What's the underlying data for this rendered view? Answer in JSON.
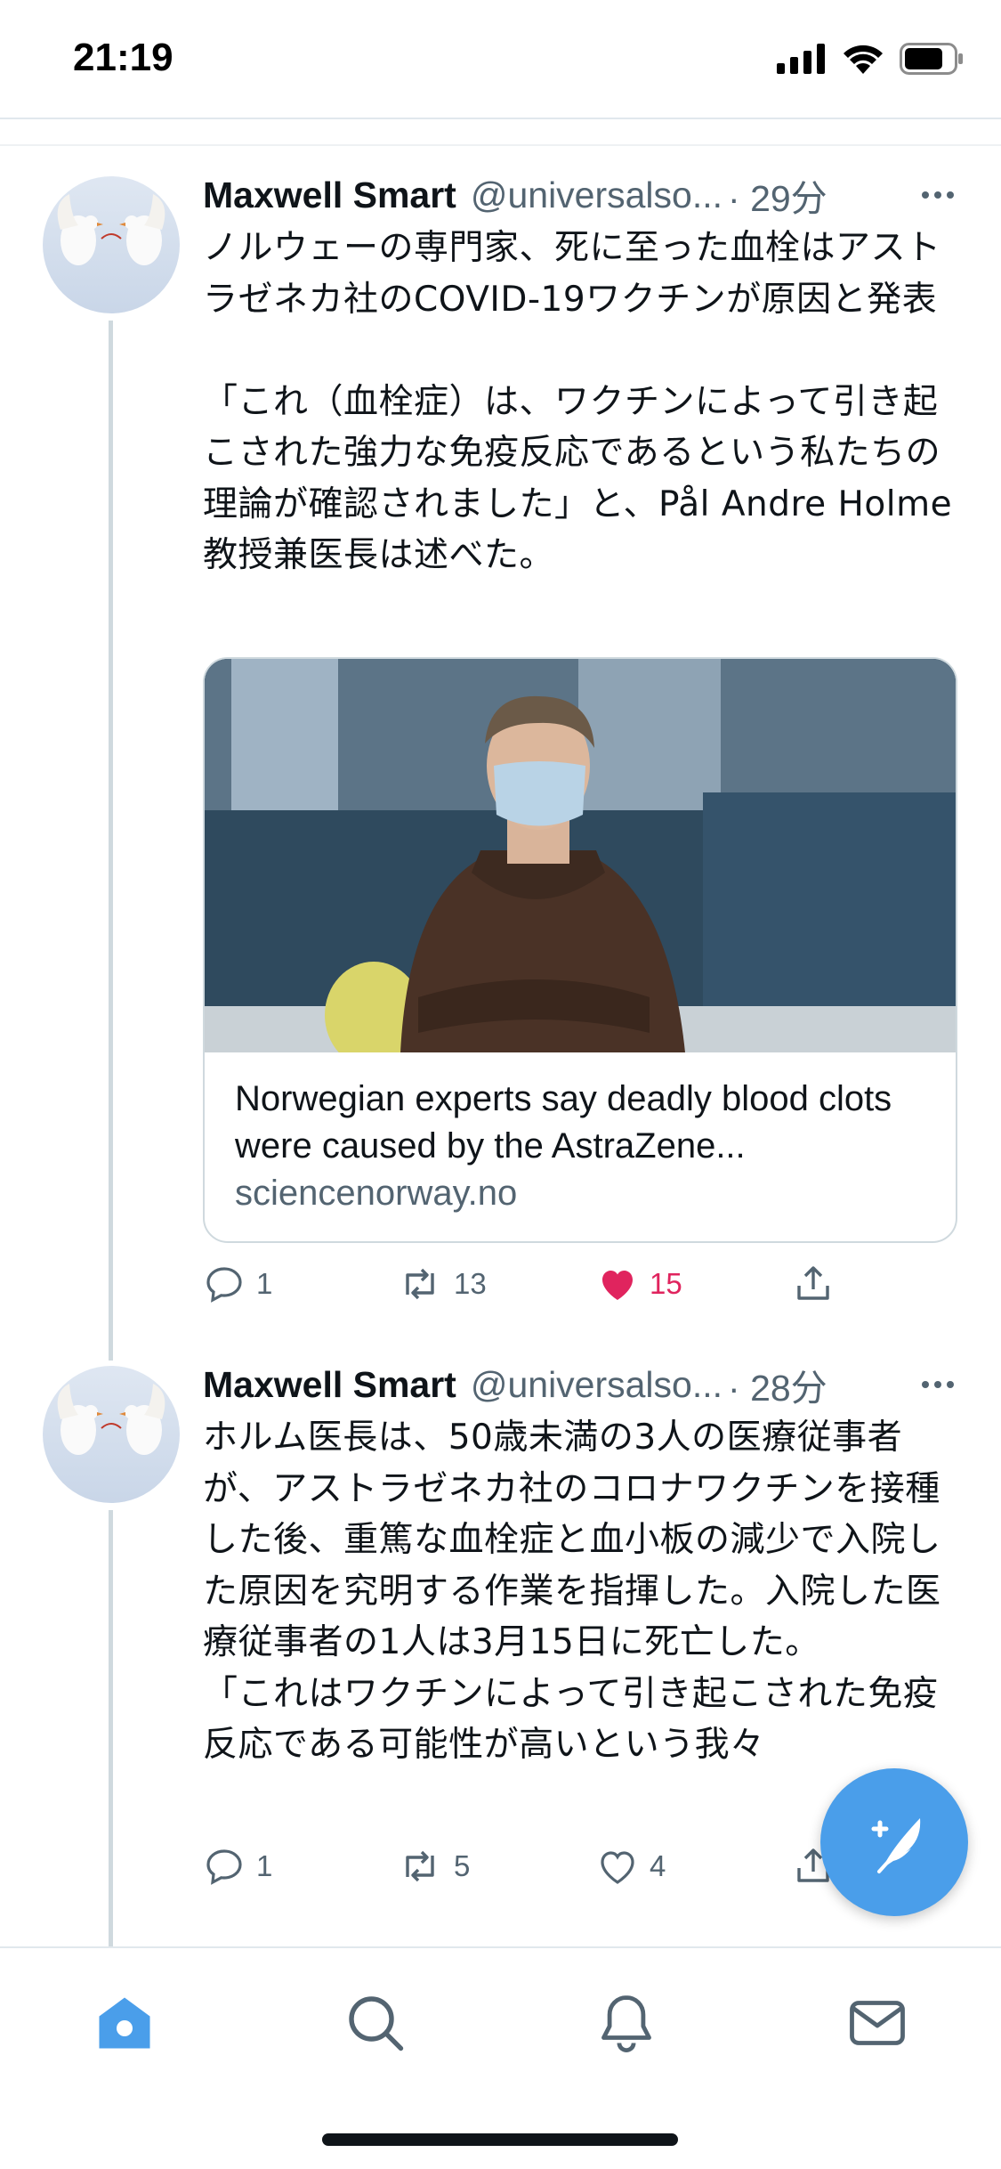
{
  "status_bar": {
    "time": "21:19"
  },
  "tweets": [
    {
      "name": "Maxwell Smart",
      "handle": "@universalso...",
      "time": "· 29分",
      "text": "ノルウェーの専門家、死に至った血栓はアストラゼネカ社のCOVID-19ワクチンが原因と発表\n\n「これ（血栓症）は、ワクチンによって引き起こされた強力な免疫反応であるという私たちの理論が確認されました」と、Pål Andre Holme 教授兼医長は述べた。",
      "card": {
        "title": "Norwegian experts say deadly blood clots were caused by the AstraZene...",
        "domain": "sciencenorway.no"
      },
      "replies": "1",
      "retweets": "13",
      "likes": "15",
      "liked": true
    },
    {
      "name": "Maxwell Smart",
      "handle": "@universalso...",
      "time": "· 28分",
      "text": "ホルム医長は、50歳未満の3人の医療従事者が、アストラゼネカ社のコロナワクチンを接種した後、重篤な血栓症と血小板の減少で入院した原因を究明する作業を指揮した。入院した医療従事者の1人は3月15日に死亡した。\n「これはワクチンによって引き起こされた免疫反応である可能性が高いという我々",
      "replies": "1",
      "retweets": "5",
      "likes": "4",
      "liked": false
    }
  ],
  "colors": {
    "accent": "#4a9eea",
    "like": "#e0245e",
    "secondary_text": "#536471",
    "divider": "#cfd9de"
  },
  "icons": {
    "reply": "reply-icon",
    "retweet": "retweet-icon",
    "like": "heart-icon",
    "share": "share-icon",
    "more": "more-icon",
    "compose": "compose-tweet-icon",
    "tabs": [
      "home-icon",
      "search-icon",
      "notifications-icon",
      "messages-icon"
    ]
  }
}
